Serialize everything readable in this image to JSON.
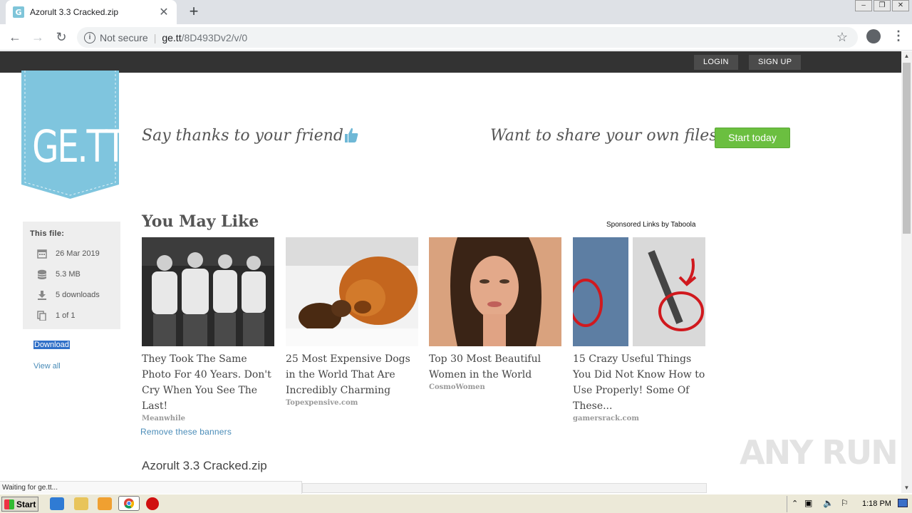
{
  "browser": {
    "tab_title": "Azorult 3.3 Cracked.zip",
    "tab_favicon": "G",
    "not_secure": "Not secure",
    "url_host": "ge.tt",
    "url_path": "/8D493Dv2/v/0",
    "status_text": "Waiting for ge.tt..."
  },
  "header": {
    "login": "LOGIN",
    "signup": "SIGN UP"
  },
  "logo_text": "GE.TT",
  "promo": {
    "thanks": "Say thanks to your friend",
    "share": "Want to share your own files?",
    "start_button": "Start today",
    "accent": "#6bbf40"
  },
  "file_info": {
    "title": "This file:",
    "date": "26 Mar 2019",
    "size": "5.3 MB",
    "downloads": "5 downloads",
    "count": "1 of 1",
    "download_link": "Download",
    "view_all": "View all"
  },
  "recommendations": {
    "heading": "You May Like",
    "sponsored": "Sponsored Links by Taboola",
    "cards": [
      {
        "title": "They Took The Same Photo For 40 Years. Don't Cry When You See The Last!",
        "source": "Meanwhile"
      },
      {
        "title": "25 Most Expensive Dogs in the World That Are Incredibly Charming",
        "source": "Topexpensive.com"
      },
      {
        "title": "Top 30 Most Beautiful Women in the World",
        "source": "CosmoWomen"
      },
      {
        "title": "15 Crazy Useful Things You Did Not Know How to Use Properly! Some Of These...",
        "source": "gamersrack.com"
      }
    ],
    "remove_banners": "Remove these banners"
  },
  "filename": "Azorult 3.3 Cracked.zip",
  "watermark": "ANY RUN",
  "taskbar": {
    "start": "Start",
    "clock": "1:18 PM"
  }
}
